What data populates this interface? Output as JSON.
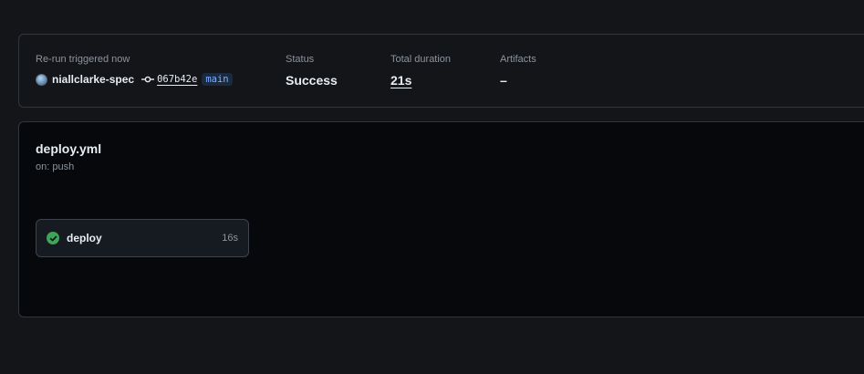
{
  "summary": {
    "trigger_label": "Re-run triggered now",
    "actor": "niallclarke-spec",
    "commit_sha": "067b42e",
    "branch": "main",
    "status_label": "Status",
    "status_value": "Success",
    "duration_label": "Total duration",
    "duration_value": "21s",
    "artifacts_label": "Artifacts",
    "artifacts_value": "–"
  },
  "workflow": {
    "file": "deploy.yml",
    "trigger": "on: push",
    "jobs": [
      {
        "name": "deploy",
        "duration": "16s",
        "status": "success",
        "icon": "check-circle-icon"
      }
    ]
  },
  "colors": {
    "success": "#3fa45a",
    "branch_text": "#79b0ff",
    "border": "#30363d"
  }
}
